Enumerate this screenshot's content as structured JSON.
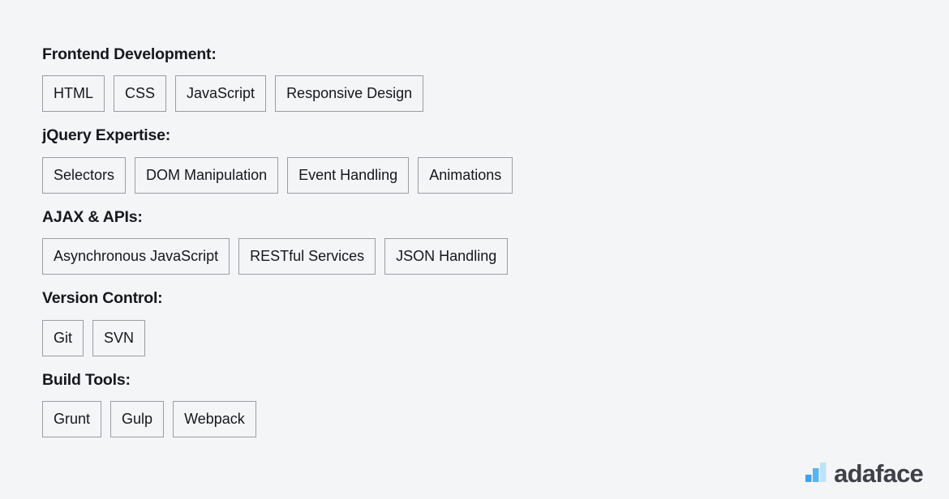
{
  "page": {
    "background_color": "#f4f5f7",
    "text_color": "#15171c",
    "tag_border_color": "#9a9da3"
  },
  "skills": {
    "sections": [
      {
        "heading": "Frontend Development:",
        "tags": [
          "HTML",
          "CSS",
          "JavaScript",
          "Responsive Design"
        ]
      },
      {
        "heading": "jQuery Expertise:",
        "tags": [
          "Selectors",
          "DOM Manipulation",
          "Event Handling",
          "Animations"
        ]
      },
      {
        "heading": "AJAX & APIs:",
        "tags": [
          "Asynchronous JavaScript",
          "RESTful Services",
          "JSON Handling"
        ]
      },
      {
        "heading": "Version Control:",
        "tags": [
          "Git",
          "SVN"
        ]
      },
      {
        "heading": "Build Tools:",
        "tags": [
          "Grunt",
          "Gulp",
          "Webpack"
        ]
      }
    ]
  },
  "branding": {
    "wordmark": "adaface",
    "mark_icon": "bar-chart-logo-icon",
    "mark_colors": {
      "bar_small": "#3fa0ef",
      "bar_medium": "#56b5f0",
      "bar_large": "#bfe2f7"
    },
    "wordmark_color": "#3f4049"
  }
}
